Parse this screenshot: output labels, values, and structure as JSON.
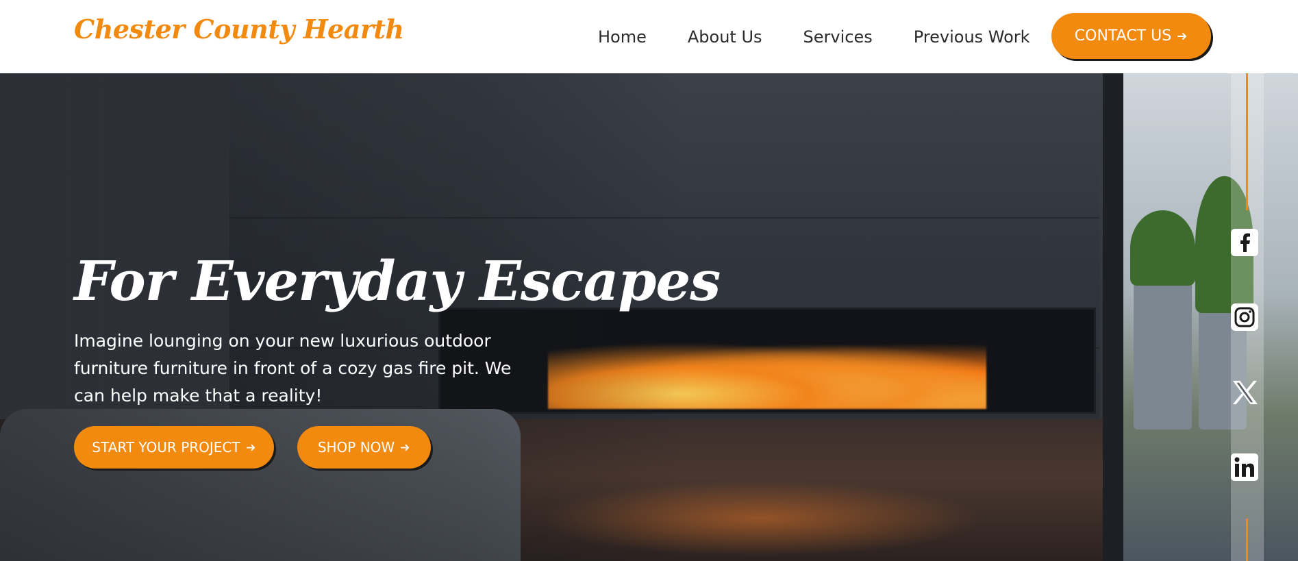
{
  "header": {
    "logo": "Chester County Hearth",
    "nav": [
      {
        "label": "Home"
      },
      {
        "label": "About Us"
      },
      {
        "label": "Services"
      },
      {
        "label": "Previous Work"
      }
    ],
    "contact_label": "CONTACT US"
  },
  "hero": {
    "headline": "For Everyday Escapes",
    "subtext": "Imagine lounging on your new luxurious outdoor furniture furniture in front of a cozy gas fire pit. We can help make that a reality!",
    "cta_start": "START YOUR PROJECT",
    "cta_shop": "SHOP NOW"
  },
  "social": [
    {
      "icon": "facebook-icon"
    },
    {
      "icon": "instagram-icon"
    },
    {
      "icon": "x-icon"
    },
    {
      "icon": "linkedin-icon"
    }
  ],
  "colors": {
    "accent": "#f28a10",
    "text_dark": "#2a2a2a",
    "white": "#ffffff"
  }
}
